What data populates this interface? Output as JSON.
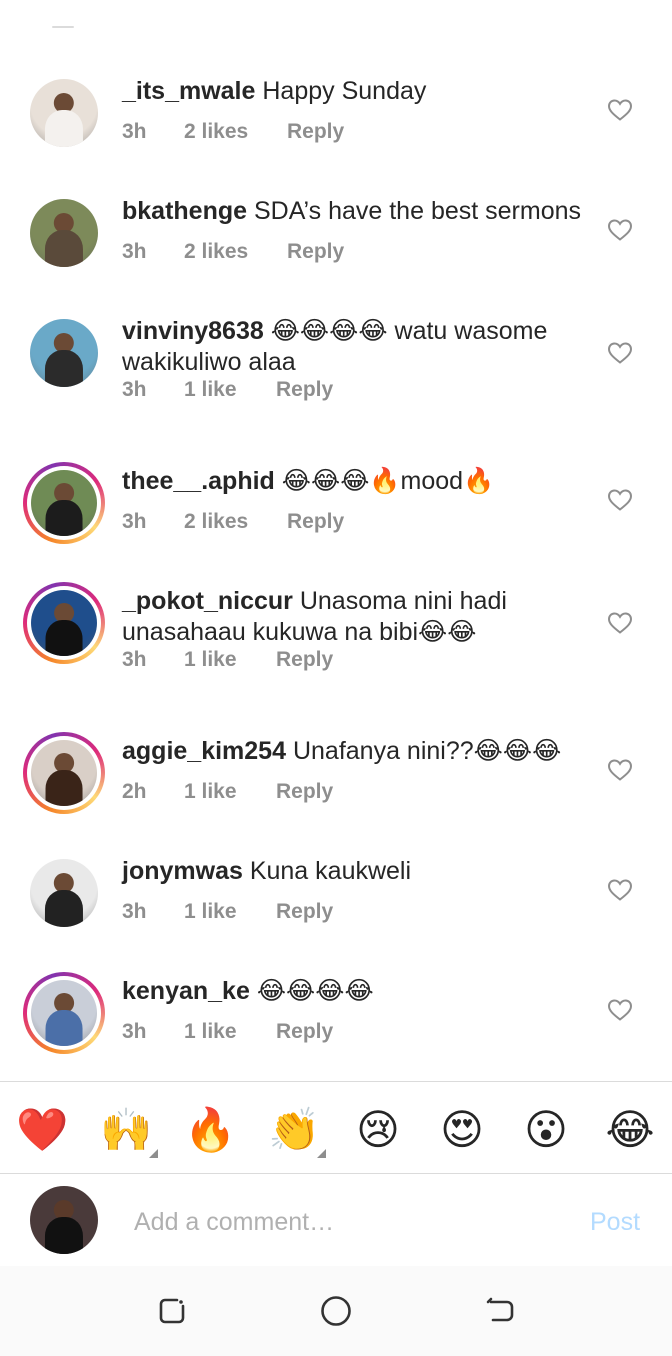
{
  "comments": [
    {
      "username": "_its_mwale",
      "text": "Happy Sunday",
      "time": "3h",
      "likes": "2 likes",
      "reply": "Reply",
      "story_ring": false,
      "avatar_bg": "#e8e0d8",
      "avatar_fig": "#f4f1ee"
    },
    {
      "username": "bkathenge",
      "text": "SDA’s have the best sermons",
      "time": "3h",
      "likes": "2 likes",
      "reply": "Reply",
      "story_ring": false,
      "avatar_bg": "#7d8a5a",
      "avatar_fig": "#5a4a3a"
    },
    {
      "username": "vinviny8638",
      "text": "😂😂😂😂 watu wasome",
      "text2": "wakikuliwo alaa",
      "time": "3h",
      "likes": "1 like",
      "reply": "Reply",
      "story_ring": false,
      "avatar_bg": "#6aa9c8",
      "avatar_fig": "#2b2b2b"
    },
    {
      "username": "thee__.aphid",
      "text": "😂😂😂🔥mood🔥",
      "time": "3h",
      "likes": "2 likes",
      "reply": "Reply",
      "story_ring": true,
      "avatar_bg": "#6f8b55",
      "avatar_fig": "#1c1c1c"
    },
    {
      "username": "_pokot_niccur",
      "text": "Unasoma nini hadi",
      "text2": "unasahaau kukuwa na bibi😂😂",
      "time": "3h",
      "likes": "1 like",
      "reply": "Reply",
      "story_ring": true,
      "avatar_bg": "#1f4e8c",
      "avatar_fig": "#111111"
    },
    {
      "username": "aggie_kim254",
      "text": "Unafanya nini??😂😂😂",
      "time": "2h",
      "likes": "1 like",
      "reply": "Reply",
      "story_ring": true,
      "avatar_bg": "#d9cfc7",
      "avatar_fig": "#3a2418"
    },
    {
      "username": "jonymwas",
      "text": "Kuna kaukweli",
      "time": "3h",
      "likes": "1 like",
      "reply": "Reply",
      "story_ring": false,
      "avatar_bg": "#e9e9e9",
      "avatar_fig": "#222222"
    },
    {
      "username": "kenyan_ke",
      "text": "😂😂😂😂",
      "time": "3h",
      "likes": "1 like",
      "reply": "Reply",
      "story_ring": true,
      "avatar_bg": "#c9ced8",
      "avatar_fig": "#4b6fa8"
    }
  ],
  "quick_reactions": [
    {
      "emoji": "❤️",
      "name": "red-heart-emoji",
      "has_variants": false
    },
    {
      "emoji": "🙌",
      "name": "raising-hands-emoji",
      "has_variants": true
    },
    {
      "emoji": "🔥",
      "name": "fire-emoji",
      "has_variants": false
    },
    {
      "emoji": "👏",
      "name": "clapping-hands-emoji",
      "has_variants": true
    },
    {
      "emoji": "😢",
      "name": "crying-face-emoji",
      "has_variants": false
    },
    {
      "emoji": "😍",
      "name": "heart-eyes-emoji",
      "has_variants": false
    },
    {
      "emoji": "😮",
      "name": "surprised-face-emoji",
      "has_variants": false
    },
    {
      "emoji": "😂",
      "name": "tears-of-joy-emoji",
      "has_variants": false
    }
  ],
  "compose": {
    "placeholder": "Add a comment…",
    "post_label": "Post",
    "avatar_bg": "#4a3a3a",
    "avatar_fig": "#111111"
  },
  "colors": {
    "text": "#262626",
    "meta": "#8e8e8e",
    "post_disabled": "#b3dbff",
    "divider": "#dbdbdb"
  }
}
